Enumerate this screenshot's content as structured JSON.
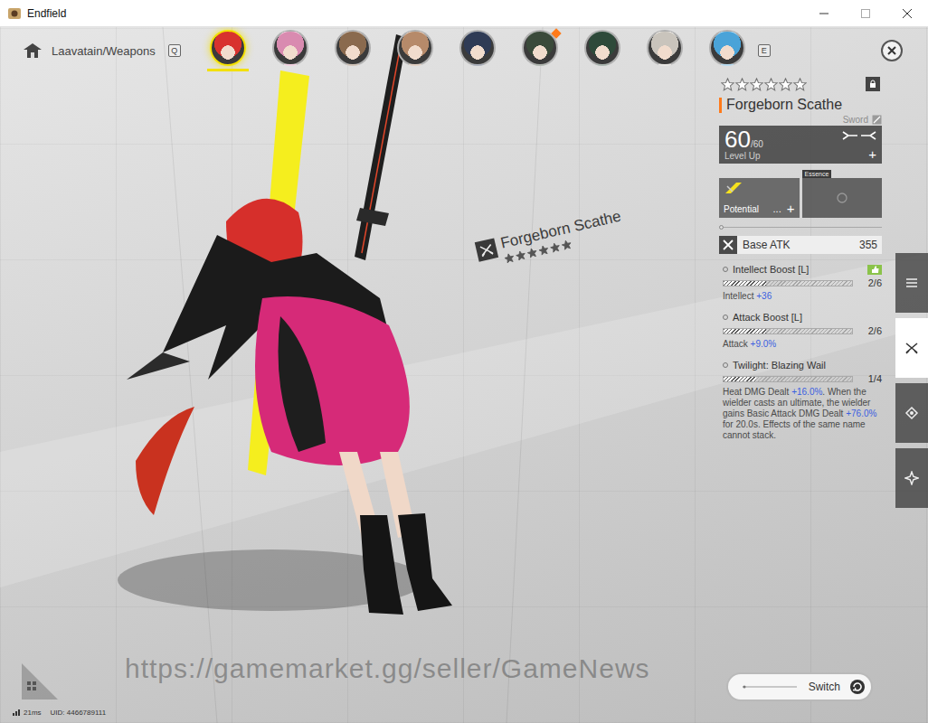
{
  "window": {
    "title": "Endfield"
  },
  "breadcrumb": {
    "label": "Laavatain/Weapons"
  },
  "key_hints": {
    "prev": "Q",
    "next": "E"
  },
  "avatars": [
    {
      "selected": true,
      "alert": false,
      "color": "#d8322e"
    },
    {
      "selected": false,
      "alert": false,
      "color": "#d98bb0"
    },
    {
      "selected": false,
      "alert": false,
      "color": "#8a6a4e"
    },
    {
      "selected": false,
      "alert": false,
      "color": "#b68a6a"
    },
    {
      "selected": false,
      "alert": false,
      "color": "#2f3b55"
    },
    {
      "selected": false,
      "alert": true,
      "color": "#3a4a3a"
    },
    {
      "selected": false,
      "alert": false,
      "color": "#2e4a3a"
    },
    {
      "selected": false,
      "alert": false,
      "color": "#c9c4bc"
    },
    {
      "selected": false,
      "alert": false,
      "color": "#4aa3d8"
    }
  ],
  "weapon": {
    "name": "Forgeborn Scathe",
    "type": "Sword",
    "stars": 6,
    "locked": true,
    "level": "60",
    "max_level": "/60",
    "level_action": "Level Up",
    "level_add": "+",
    "breakthroughs": [
      true,
      true
    ],
    "potential": {
      "label": "Potential",
      "more": "...",
      "add": "+"
    },
    "essence": {
      "label": "Essence"
    },
    "base_atk": {
      "label": "Base ATK",
      "value": "355"
    }
  },
  "stats": [
    {
      "name": "Intellect Boost [L]",
      "rank": "2/6",
      "level": 0.33,
      "recommended": true,
      "description": [
        {
          "text": "Intellect ",
          "hl": false
        },
        {
          "text": "+36",
          "hl": true
        }
      ]
    },
    {
      "name": "Attack Boost [L]",
      "rank": "2/6",
      "level": 0.33,
      "recommended": false,
      "description": [
        {
          "text": "Attack ",
          "hl": false
        },
        {
          "text": "+9.0%",
          "hl": true
        }
      ]
    },
    {
      "name": "Twilight: Blazing Wail",
      "rank": "1/4",
      "level": 0.25,
      "recommended": false,
      "description": [
        {
          "text": "Heat DMG Dealt ",
          "hl": false
        },
        {
          "text": "+16.0%",
          "hl": true
        },
        {
          "text": ". When the wielder casts an ultimate, the wielder gains Basic Attack DMG Dealt ",
          "hl": false
        },
        {
          "text": "+76.0%",
          "hl": true
        },
        {
          "text": " for 20.0s. Effects of the same name cannot stack.",
          "hl": false
        }
      ]
    }
  ],
  "side_tabs": [
    {
      "kind": "list",
      "selected": false
    },
    {
      "kind": "weapon",
      "selected": true
    },
    {
      "kind": "gear",
      "selected": false
    },
    {
      "kind": "star",
      "selected": false
    }
  ],
  "scene_label": {
    "name": "Forgeborn Scathe",
    "stars": 6
  },
  "switch_button": {
    "label": "Switch"
  },
  "status": {
    "ping": "21ms",
    "uid": "UID: 4466789111"
  },
  "watermark": "https://gamemarket.gg/seller/GameNews"
}
